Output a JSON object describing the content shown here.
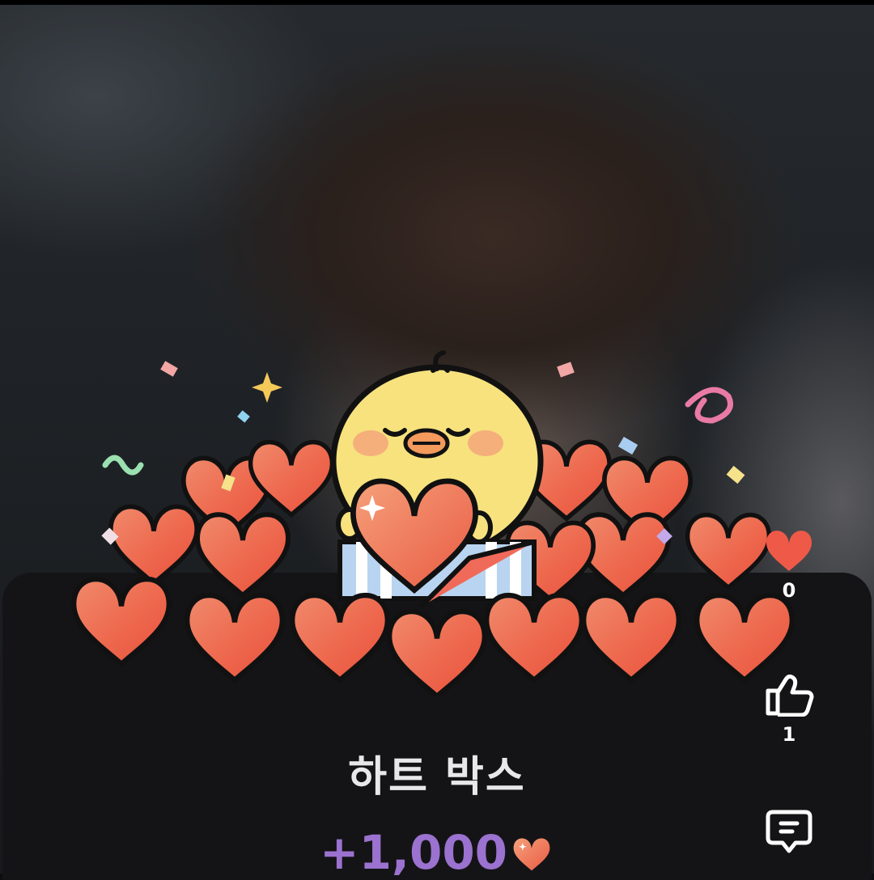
{
  "reward": {
    "title": "하트 박스",
    "amount": "+1,000"
  },
  "actions": {
    "heart_count": "0",
    "like_count": "1"
  },
  "icons": {
    "heart": "heart-icon",
    "like": "thumbs-up-icon",
    "comment": "comment-icon",
    "amount_heart": "heart-icon"
  },
  "colors": {
    "amount": "#9b72cf",
    "heart": "#ef5a48",
    "sheet": "#141416"
  }
}
